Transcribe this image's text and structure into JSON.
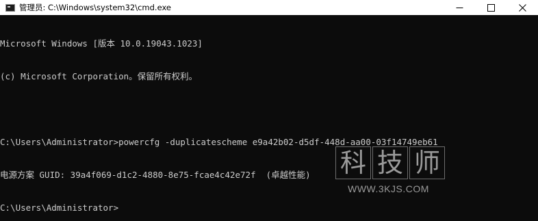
{
  "window": {
    "title": "管理员: C:\\Windows\\system32\\cmd.exe",
    "icon": "console-icon"
  },
  "controls": {
    "minimize_icon": "minimize-icon",
    "maximize_icon": "maximize-icon",
    "close_icon": "close-icon"
  },
  "console": {
    "lines": [
      "Microsoft Windows [版本 10.0.19043.1023]",
      "(c) Microsoft Corporation。保留所有权利。",
      "",
      "C:\\Users\\Administrator>powercfg -duplicatescheme e9a42b02-d5df-448d-aa00-03f14749eb61",
      "电源方案 GUID: 39a4f069-d1c2-4880-8e75-fcae4c42e72f  (卓越性能)",
      "C:\\Users\\Administrator>"
    ]
  },
  "watermark": {
    "chars": [
      "科",
      "技",
      "师"
    ],
    "url": "WWW.3KJS.COM"
  },
  "colors": {
    "background": "#0c0c0c",
    "text": "#cccccc",
    "titlebar": "#ffffff"
  }
}
